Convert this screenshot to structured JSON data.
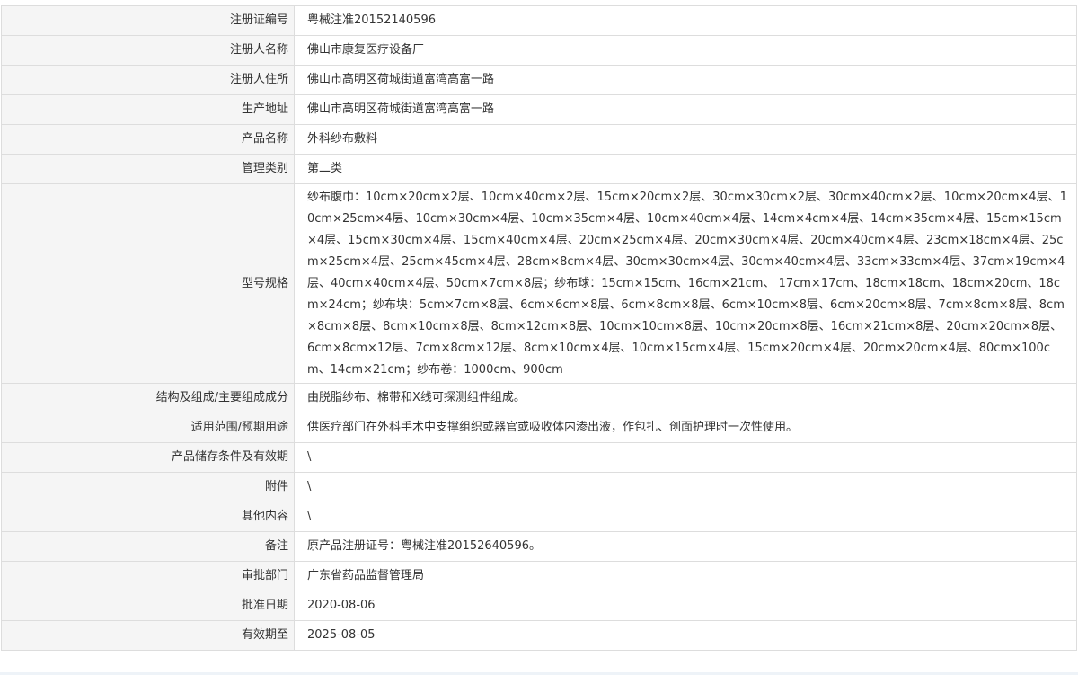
{
  "rows": [
    {
      "label": "注册证编号",
      "value": "粤械注准20152140596"
    },
    {
      "label": "注册人名称",
      "value": "佛山市康复医疗设备厂"
    },
    {
      "label": "注册人住所",
      "value": "佛山市高明区荷城街道富湾高富一路"
    },
    {
      "label": "生产地址",
      "value": "佛山市高明区荷城街道富湾高富一路"
    },
    {
      "label": "产品名称",
      "value": "外科纱布敷料"
    },
    {
      "label": "管理类别",
      "value": "第二类"
    },
    {
      "label": "型号规格",
      "value": "纱布腹巾：10cm×20cm×2层、10cm×40cm×2层、15cm×20cm×2层、30cm×30cm×2层、30cm×40cm×2层、10cm×20cm×4层、10cm×25cm×4层、10cm×30cm×4层、10cm×35cm×4层、10cm×40cm×4层、14cm×4cm×4层、14cm×35cm×4层、15cm×15cm×4层、15cm×30cm×4层、15cm×40cm×4层、20cm×25cm×4层、20cm×30cm×4层、20cm×40cm×4层、23cm×18cm×4层、25cm×25cm×4层、25cm×45cm×4层、28cm×8cm×4层、30cm×30cm×4层、30cm×40cm×4层、33cm×33cm×4层、37cm×19cm×4层、40cm×40cm×4层、50cm×7cm×8层；纱布球：15cm×15cm、16cm×21cm、 17cm×17cm、18cm×18cm、18cm×20cm、18cm×24cm；纱布块：5cm×7cm×8层、6cm×6cm×8层、6cm×8cm×8层、6cm×10cm×8层、6cm×20cm×8层、7cm×8cm×8层、8cm×8cm×8层、8cm×10cm×8层、8cm×12cm×8层、10cm×10cm×8层、10cm×20cm×8层、16cm×21cm×8层、20cm×20cm×8层、6cm×8cm×12层、7cm×8cm×12层、8cm×10cm×4层、10cm×15cm×4层、15cm×20cm×4层、20cm×20cm×4层、80cm×100cm、14cm×21cm；纱布卷：1000cm、900cm"
    },
    {
      "label": "结构及组成/主要组成成分",
      "value": "由脱脂纱布、棉带和X线可探测组件组成。"
    },
    {
      "label": "适用范围/预期用途",
      "value": "供医疗部门在外科手术中支撑组织或器官或吸收体内渗出液，作包扎、创面护理时一次性使用。"
    },
    {
      "label": "产品储存条件及有效期",
      "value": "\\"
    },
    {
      "label": "附件",
      "value": "\\"
    },
    {
      "label": "其他内容",
      "value": "\\"
    },
    {
      "label": "备注",
      "value": "原产品注册证号：粤械注准20152640596。"
    },
    {
      "label": "审批部门",
      "value": "广东省药品监督管理局"
    },
    {
      "label": "批准日期",
      "value": "2020-08-06"
    },
    {
      "label": "有效期至",
      "value": "2025-08-05"
    }
  ]
}
